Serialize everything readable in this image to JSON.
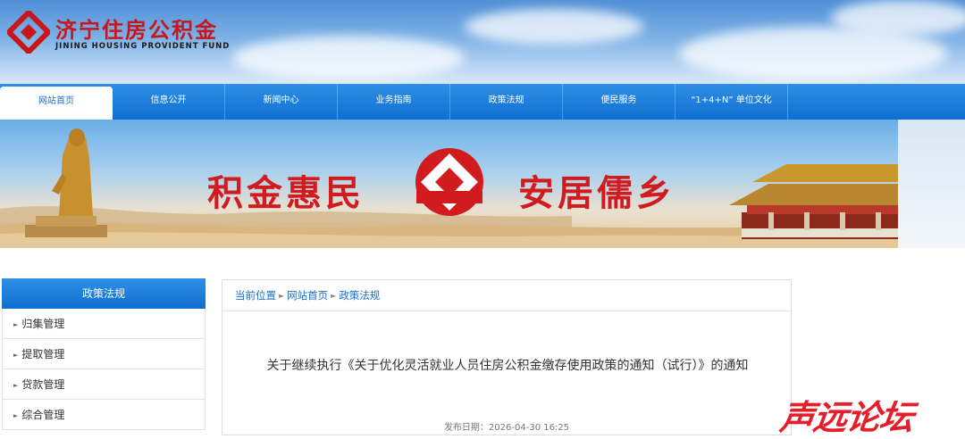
{
  "header": {
    "logo_cn": "济宁住房公积金",
    "logo_en": "JINING HOUSING PROVIDENT FUND"
  },
  "nav": {
    "items": [
      {
        "label": "网站首页",
        "active": true
      },
      {
        "label": "信息公开"
      },
      {
        "label": "新闻中心"
      },
      {
        "label": "业务指南"
      },
      {
        "label": "政策法规"
      },
      {
        "label": "便民服务"
      },
      {
        "label": "“1+4+N” 单位文化"
      }
    ]
  },
  "banner": {
    "slogan_left": "积金惠民",
    "slogan_right": "安居儒乡"
  },
  "sidebar": {
    "title": "政策法规",
    "items": [
      {
        "label": "归集管理"
      },
      {
        "label": "提取管理"
      },
      {
        "label": "贷款管理"
      },
      {
        "label": "综合管理"
      }
    ]
  },
  "breadcrumb": {
    "items": [
      "当前位置",
      "网站首页",
      "政策法规"
    ]
  },
  "article": {
    "title": "关于继续执行《关于优化灵活就业人员住房公积金缴存使用政策的通知（试行）》的通知",
    "date": "发布日期：2026-04-30 16:25"
  },
  "watermark": "声远论坛",
  "colors": {
    "brand_red": "#d21b1f",
    "nav_blue": "#0e6fd1",
    "link_blue": "#1a6fc9"
  }
}
